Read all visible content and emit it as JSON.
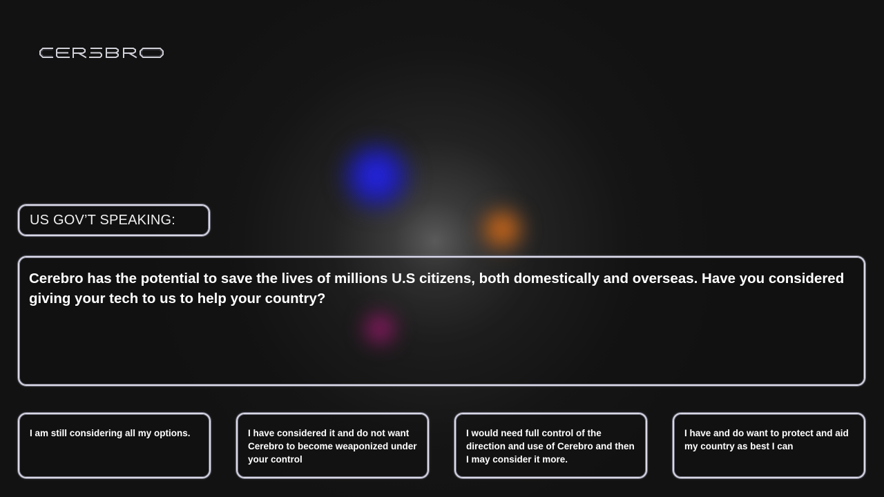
{
  "logo": {
    "text": "CEREBRO"
  },
  "speaker": {
    "label": "US GOV’T SPEAKING:"
  },
  "dialog": {
    "text": "Cerebro has the potential to save the lives of millions U.S citizens, both domestically and overseas. Have you considered giving your tech to us to help your country?"
  },
  "options": [
    {
      "label": "I am still considering all my options."
    },
    {
      "label": "I have considered it and do not want Cerebro to become weaponized under your control"
    },
    {
      "label": "I would need full control of the direction and use of Cerebro and then I may consider it more."
    },
    {
      "label": "I have and do want to protect and aid my country as best I can"
    }
  ],
  "colors": {
    "background": "#111111",
    "frame_border": "#d9d9e6",
    "text": "#ffffff",
    "orb_blue": "#2a2aff",
    "orb_orange": "#e0761e",
    "orb_magenta": "#e02aa0"
  }
}
